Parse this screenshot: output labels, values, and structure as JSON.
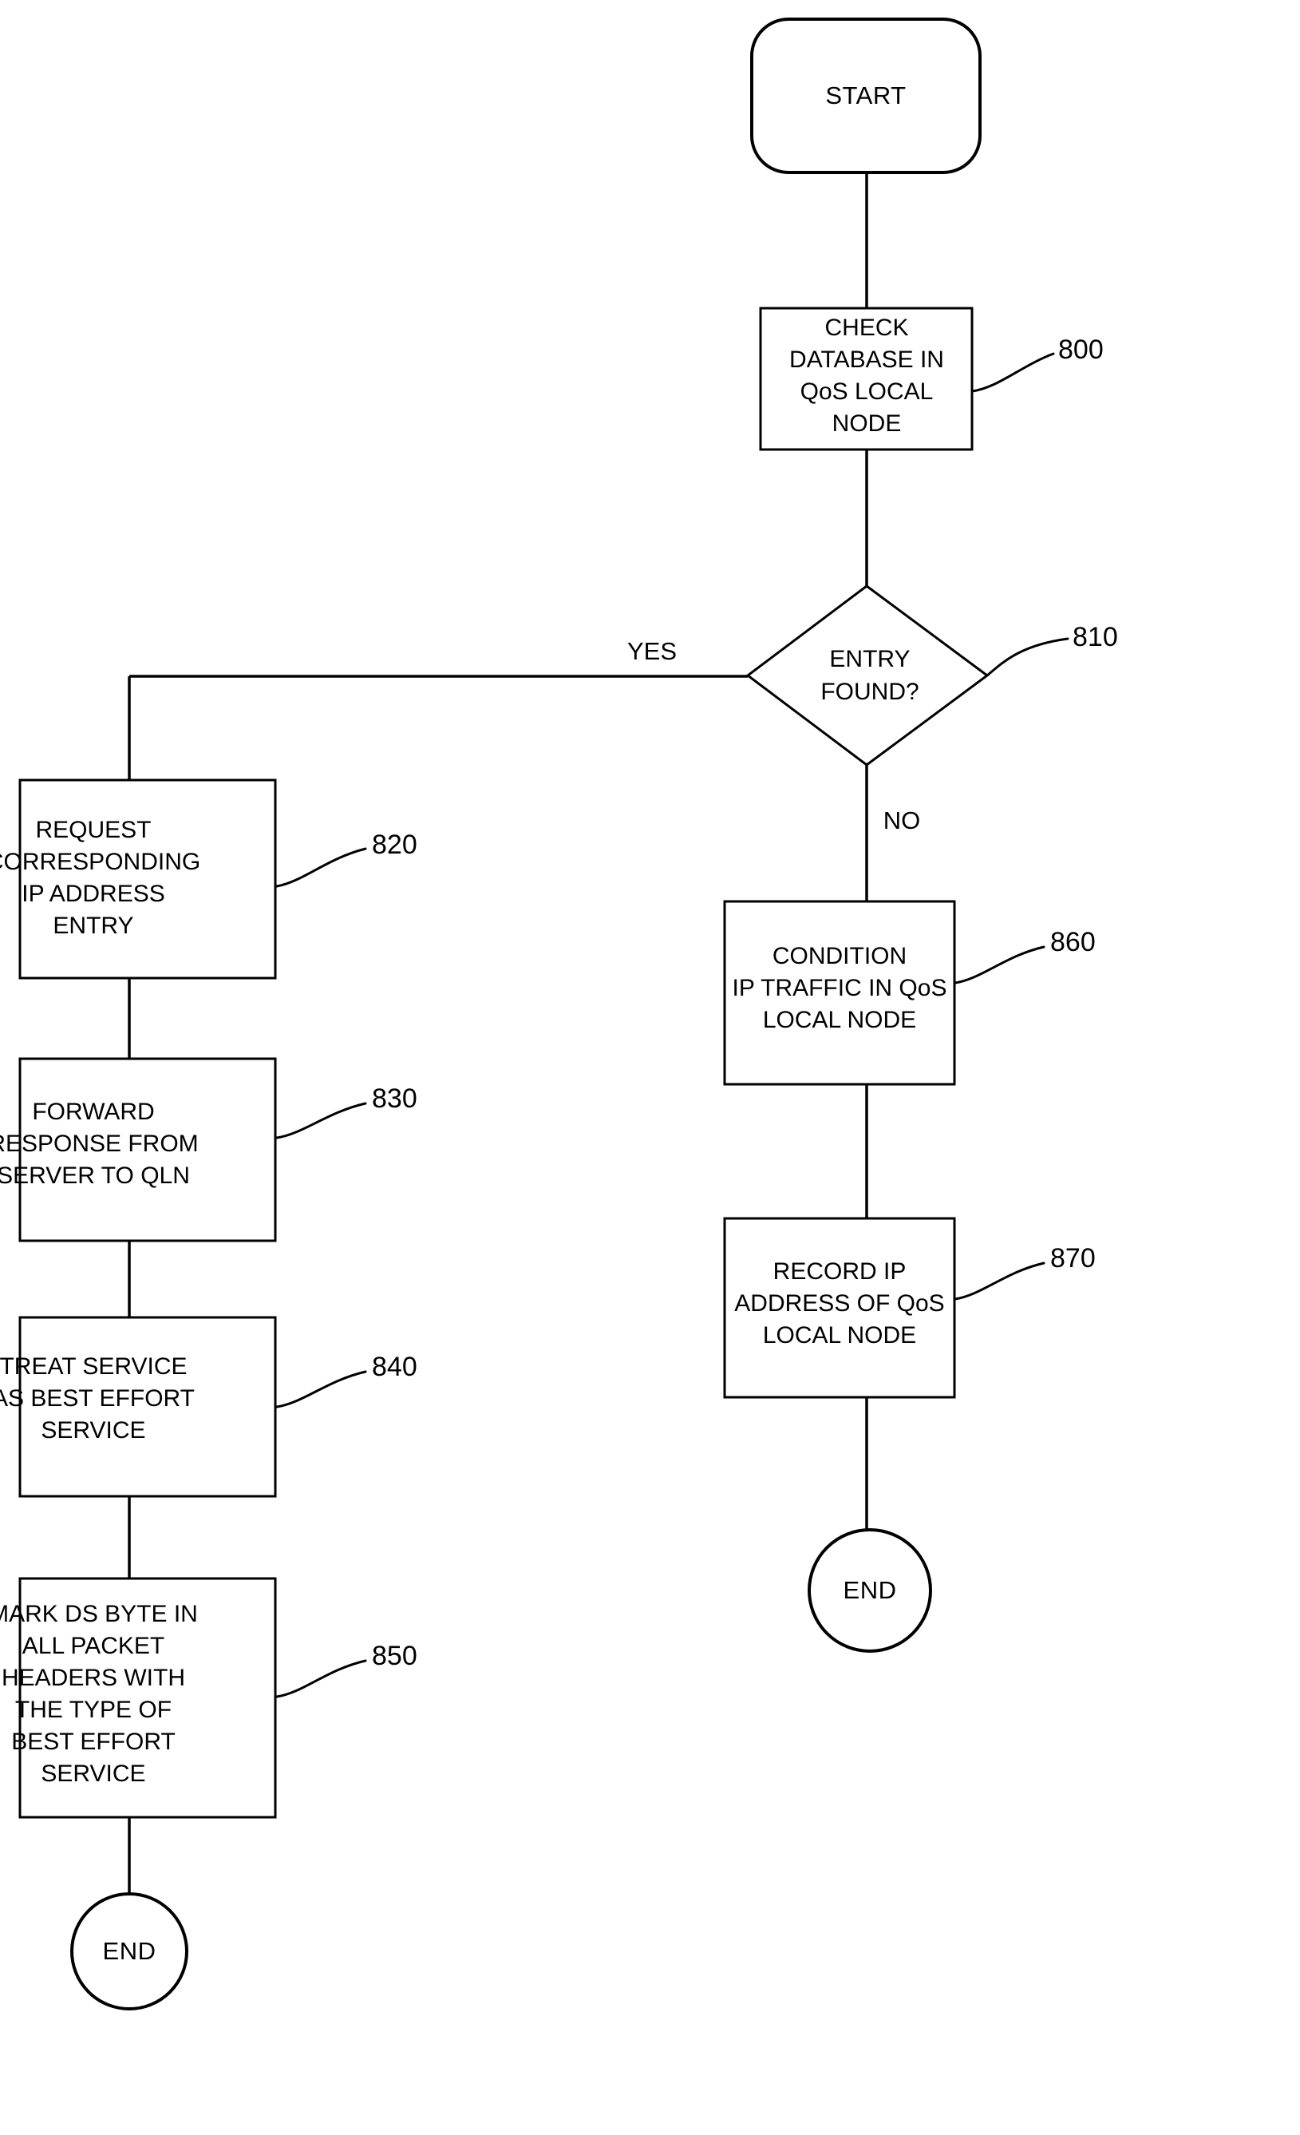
{
  "diagram": {
    "type": "flowchart",
    "title": "",
    "nodes": {
      "start": {
        "label": "START",
        "shape": "rounded-terminal"
      },
      "check_db": {
        "lines": [
          "CHECK",
          "DATABASE IN",
          "QoS LOCAL",
          "NODE"
        ],
        "ref": "800",
        "shape": "process"
      },
      "entry_found": {
        "lines": [
          "ENTRY",
          "FOUND?"
        ],
        "ref": "810",
        "shape": "decision"
      },
      "request_ip": {
        "lines": [
          "REQUEST",
          "CORRESPONDING",
          "IP ADDRESS",
          "ENTRY"
        ],
        "ref": "820",
        "shape": "process"
      },
      "forward_response": {
        "lines": [
          "FORWARD",
          "RESPONSE FROM",
          "SERVER TO QLN"
        ],
        "ref": "830",
        "shape": "process"
      },
      "treat_service": {
        "lines": [
          "TREAT SERVICE",
          "AS BEST EFFORT",
          "SERVICE"
        ],
        "ref": "840",
        "shape": "process"
      },
      "mark_ds_byte": {
        "lines": [
          "MARK DS BYTE IN",
          "ALL PACKET",
          "HEADERS WITH",
          "THE TYPE OF",
          "BEST EFFORT",
          "SERVICE"
        ],
        "ref": "850",
        "shape": "process"
      },
      "condition_traffic": {
        "lines": [
          "CONDITION",
          "IP TRAFFIC IN QoS",
          "LOCAL NODE"
        ],
        "ref": "860",
        "shape": "process"
      },
      "record_ip": {
        "lines": [
          "RECORD IP",
          "ADDRESS OF QoS",
          "LOCAL NODE"
        ],
        "ref": "870",
        "shape": "process"
      },
      "end_left": {
        "label": "END",
        "shape": "circle-terminal"
      },
      "end_right": {
        "label": "END",
        "shape": "circle-terminal"
      }
    },
    "branch_labels": {
      "yes": "YES",
      "no": "NO"
    },
    "colors": {
      "stroke": "#000000",
      "fill": "#ffffff",
      "text": "#000000"
    }
  }
}
